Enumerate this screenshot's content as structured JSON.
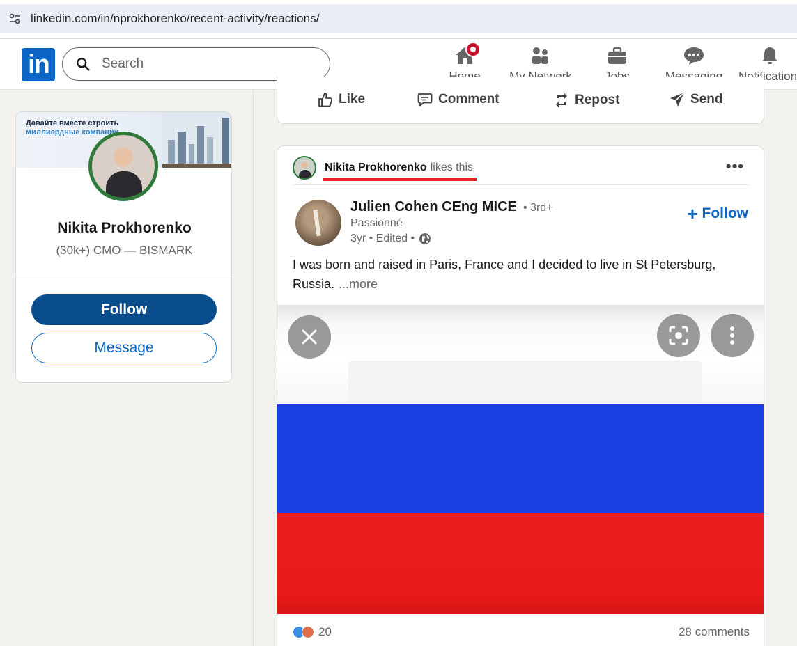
{
  "browser": {
    "url": "linkedin.com/in/nprokhorenko/recent-activity/reactions/"
  },
  "nav": {
    "logo": "in",
    "search_placeholder": "Search",
    "items": [
      {
        "label": "Home",
        "icon": "home-icon"
      },
      {
        "label": "My Network",
        "icon": "network-icon"
      },
      {
        "label": "Jobs",
        "icon": "briefcase-icon"
      },
      {
        "label": "Messaging",
        "icon": "messaging-icon"
      },
      {
        "label": "Notification",
        "icon": "bell-icon"
      }
    ]
  },
  "profile": {
    "banner_line1": "Давайте вместе строить",
    "banner_line2": "миллиардные компании",
    "name": "Nikita Prokhorenko",
    "subtitle": "(30k+) CMO — BISMARK",
    "follow_label": "Follow",
    "message_label": "Message",
    "open_to_work_color": "#2f7a3a"
  },
  "prev_post_actions": [
    {
      "label": "Like",
      "icon": "like-icon"
    },
    {
      "label": "Comment",
      "icon": "comment-icon"
    },
    {
      "label": "Repost",
      "icon": "repost-icon"
    },
    {
      "label": "Send",
      "icon": "send-icon"
    }
  ],
  "post": {
    "liker_name": "Nikita Prokhorenko",
    "liker_action": "likes this",
    "author_name": "Julien Cohen CEng MICE",
    "author_degree": "• 3rd+",
    "author_headline": "Passionné",
    "author_meta": "3yr • Edited •",
    "follow_label": "Follow",
    "text": "I was born and raised in Paris, France and I decided to live in St Petersburg, Russia.",
    "more_label": "...more",
    "reaction_count": "20",
    "comments_label": "28 comments",
    "image_colors": {
      "white": "#ffffff",
      "blue": "#1a3fe0",
      "red": "#ea1f1f"
    }
  },
  "colors": {
    "linkedin_blue": "#0a66c2",
    "follow_button_bg": "#0a4d8c",
    "highlight_underline": "#e8202a"
  }
}
